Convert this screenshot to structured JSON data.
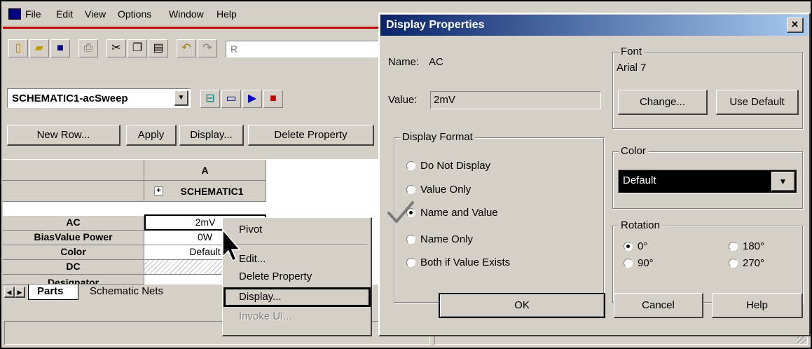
{
  "menu": {
    "items": [
      "File",
      "Edit",
      "View",
      "Options",
      "Window",
      "Help"
    ]
  },
  "toolbar": {
    "icons": [
      "new-icon",
      "open-icon",
      "save-icon",
      "print-icon",
      "cut-icon",
      "copy-icon",
      "paste-icon",
      "undo-icon",
      "redo-icon"
    ],
    "search_value": "R",
    "profile_select": "SCHEMATIC1-acSweep"
  },
  "prop_toolbar": {
    "new_row": "New Row...",
    "apply": "Apply",
    "display": "Display...",
    "delete": "Delete Property"
  },
  "grid": {
    "column_header": "A",
    "column_name": "SCHEMATIC1",
    "expand": "+",
    "rows": [
      {
        "label": "AC",
        "value": "2mV"
      },
      {
        "label": "BiasValue Power",
        "value": "0W"
      },
      {
        "label": "Color",
        "value": "Default"
      },
      {
        "label": "DC",
        "value": ""
      },
      {
        "label": "Designator",
        "value": ""
      }
    ]
  },
  "tabs": {
    "parts": "Parts",
    "nets": "Schematic Nets"
  },
  "context_menu": {
    "items": [
      {
        "label": "Pivot",
        "enabled": true
      },
      {
        "label": "Edit...",
        "enabled": true
      },
      {
        "label": "Delete Property",
        "enabled": true
      },
      {
        "label": "Display...",
        "enabled": true
      },
      {
        "label": "Invoke UI...",
        "enabled": false
      }
    ]
  },
  "dialog": {
    "title": "Display Properties",
    "close": "×",
    "name_label": "Name:",
    "name_value": "AC",
    "value_label": "Value:",
    "value_value": "2mV",
    "font": {
      "title": "Font",
      "current": "Arial 7",
      "change": "Change...",
      "use_default": "Use Default"
    },
    "display_format": {
      "title": "Display Format",
      "options": [
        "Do Not Display",
        "Value Only",
        "Name and Value",
        "Name Only",
        "Both if Value Exists"
      ],
      "selected_index": 2
    },
    "color": {
      "title": "Color",
      "value": "Default"
    },
    "rotation": {
      "title": "Rotation",
      "options": [
        "0°",
        "180°",
        "90°",
        "270°"
      ],
      "selected_index": 0
    },
    "ok": "OK",
    "cancel": "Cancel",
    "help": "Help",
    "title_gradient_start": "#0a246a",
    "title_gradient_end": "#a6caf0"
  }
}
